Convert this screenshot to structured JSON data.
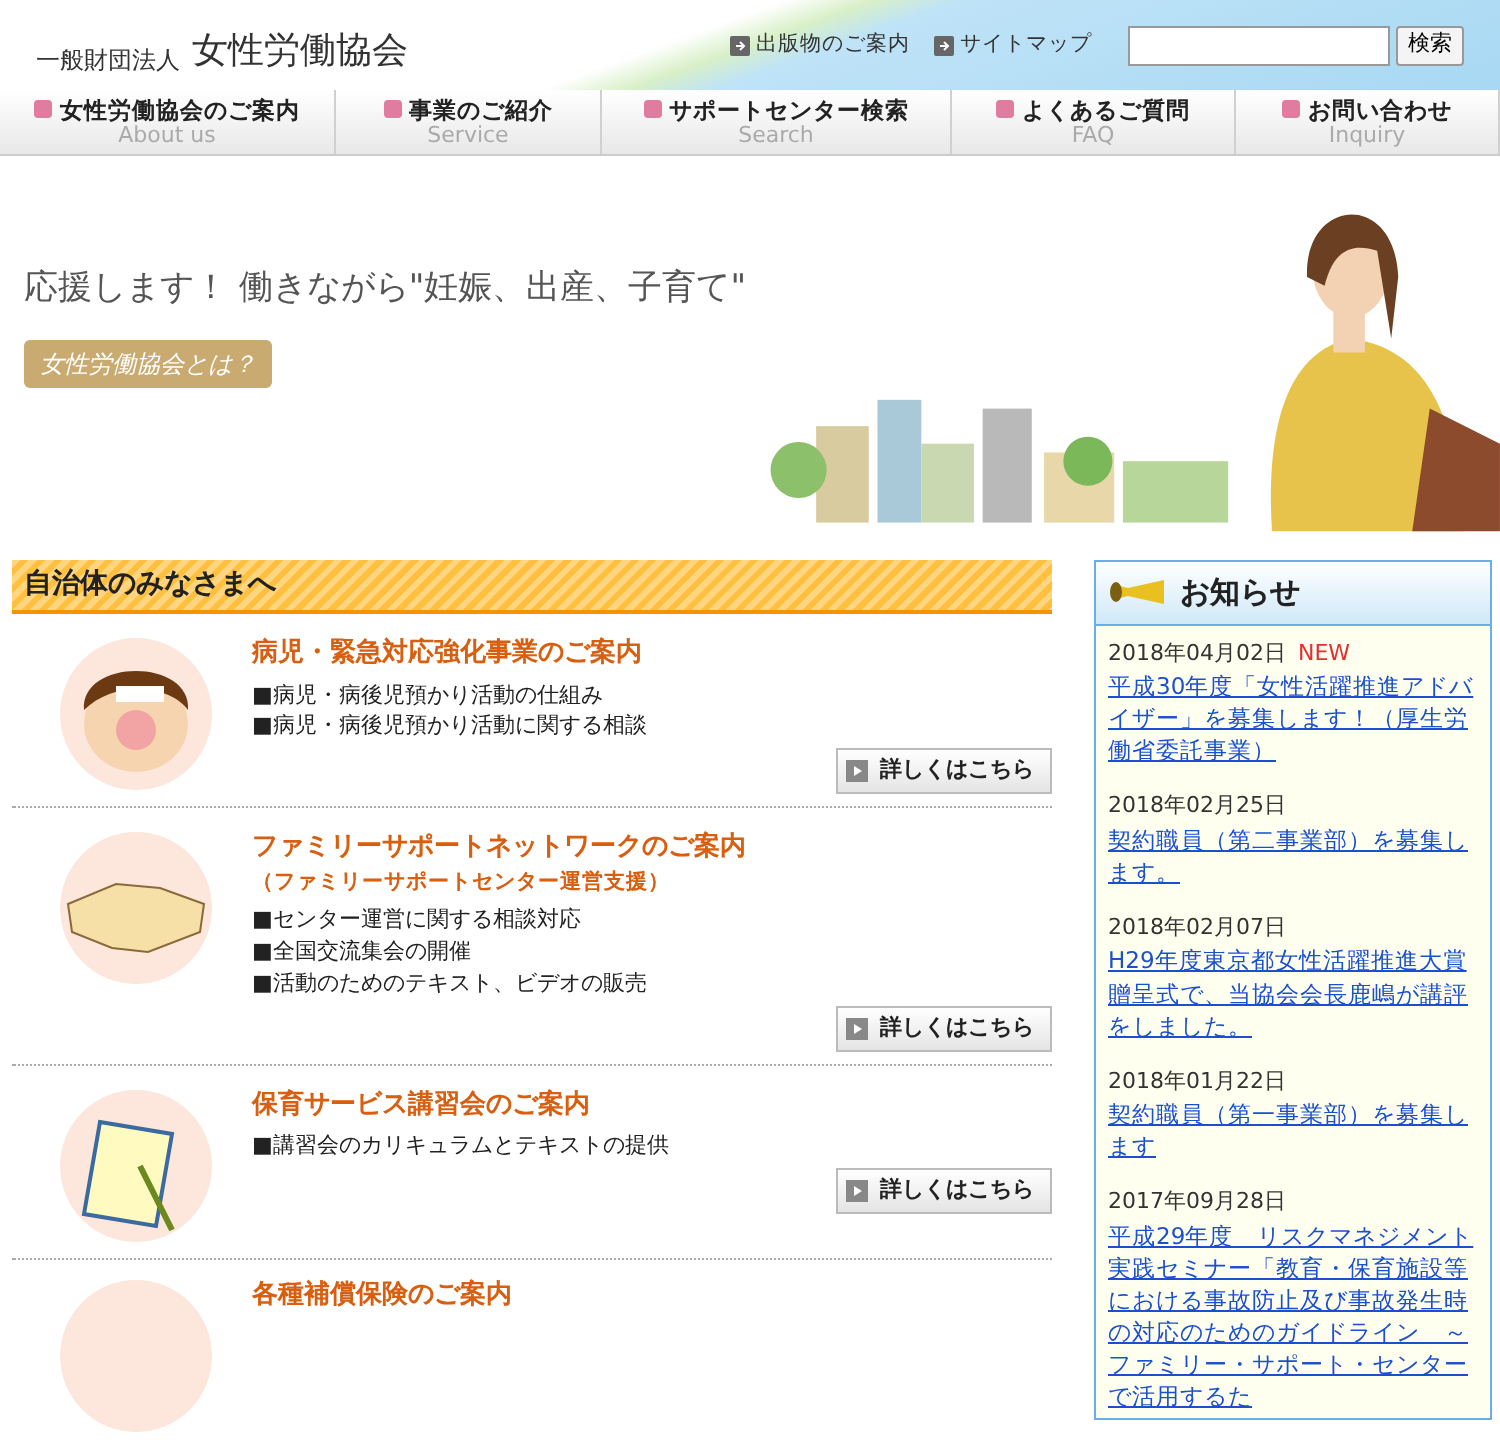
{
  "header": {
    "org_prefix": "一般財団法人",
    "org_name": "女性労働協会",
    "links": [
      "出版物のご案内",
      "サイトマップ"
    ],
    "search_button": "検索"
  },
  "nav": [
    {
      "label": "女性労働協会のご案内",
      "sublabel": "About us"
    },
    {
      "label": "事業のご紹介",
      "sublabel": "Service"
    },
    {
      "label": "サポートセンター検索",
      "sublabel": "Search"
    },
    {
      "label": "よくあるご質問",
      "sublabel": "FAQ"
    },
    {
      "label": "お問い合わせ",
      "sublabel": "Inquiry"
    }
  ],
  "hero": {
    "headline": "応援します！ 働きながら\"妊娠、出産、子育て\"",
    "button": "女性労働協会とは？"
  },
  "section": {
    "title": "自治体のみなさまへ",
    "items": [
      {
        "kind": "sick-child",
        "title": "病児・緊急対応強化事業のご案内",
        "bullets": [
          "■病児・病後児預かり活動の仕組み",
          "■病児・病後児預かり活動に関する相談"
        ],
        "button": "詳しくはこちら"
      },
      {
        "kind": "handshake",
        "title": "ファミリーサポートネットワークのご案内",
        "subtitle": "（ファミリーサポートセンター運営支援）",
        "bullets": [
          "■センター運営に関する相談対応",
          "■全国交流集会の開催",
          "■活動のためのテキスト、ビデオの販売"
        ],
        "button": "詳しくはこちら"
      },
      {
        "kind": "notebook",
        "title": "保育サービス講習会のご案内",
        "bullets": [
          "■講習会のカリキュラムとテキストの提供"
        ],
        "button": "詳しくはこちら"
      },
      {
        "kind": "insurance",
        "title": "各種補償保険のご案内"
      }
    ]
  },
  "news": {
    "title": "お知らせ",
    "items": [
      {
        "date": "2018年04月02日",
        "badge": "NEW",
        "text": "平成30年度「女性活躍推進アドバイザー」を募集します！（厚生労働省委託事業）"
      },
      {
        "date": "2018年02月25日",
        "text": "契約職員（第二事業部）を募集します。"
      },
      {
        "date": "2018年02月07日",
        "text": "H29年度東京都女性活躍推進大賞贈呈式で、当協会会長鹿嶋が講評をしました。"
      },
      {
        "date": "2018年01月22日",
        "text": "契約職員（第一事業部）を募集します"
      },
      {
        "date": "2017年09月28日",
        "text": "平成29年度　リスクマネジメント実践セミナー「教育・保育施設等における事故防止及び事故発生時の対応のためのガイドライン　～ファミリー・サポート・センターで活用するた"
      }
    ]
  }
}
